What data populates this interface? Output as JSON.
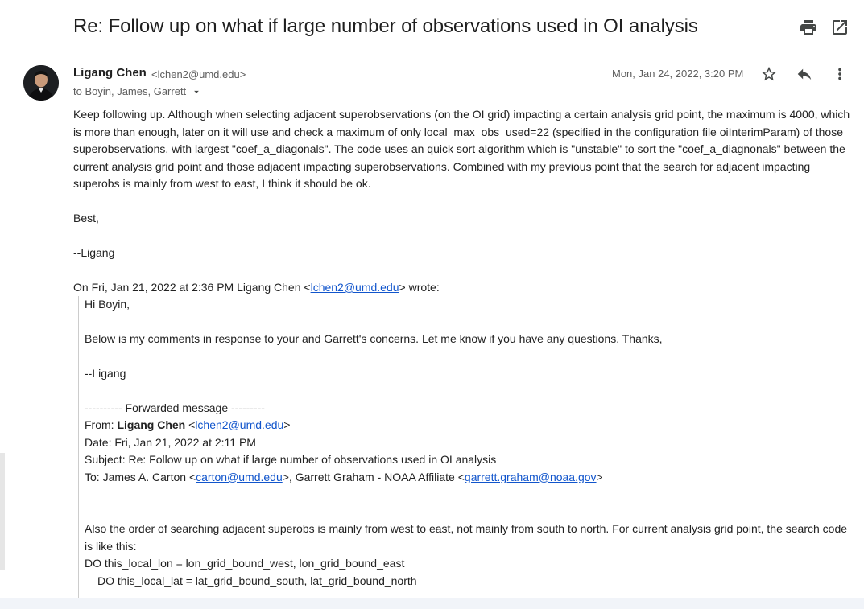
{
  "email": {
    "subject": "Re: Follow up on what if large number of observations used in OI analysis",
    "sender_name": "Ligang Chen",
    "sender_email": "<lchen2@umd.edu>",
    "recipients": "to Boyin, James, Garrett",
    "date": "Mon, Jan 24, 2022, 3:20 PM",
    "body_paragraph": "Keep following up. Although when selecting adjacent superobservations (on the OI grid) impacting a certain analysis grid point, the maximum is 4000, which is more than enough, later on it will use and check a maximum of only local_max_obs_used=22 (specified in the configuration file oiInterimParam) of those superobservations, with largest \"coef_a_diagonals\". The code uses an quick sort algorithm which is \"unstable\" to sort the \"coef_a_diagnonals\" between the current analysis grid point and those adjacent impacting superobservations. Combined with my previous point that the search for adjacent impacting superobs is mainly from west to east, I think it should be ok.",
    "closing": "Best,",
    "signature": "--Ligang",
    "quote_intro_prefix": "On Fri, Jan 21, 2022 at 2:36 PM Ligang Chen <",
    "quote_intro_link": "lchen2@umd.edu",
    "quote_intro_suffix": "> wrote:"
  },
  "quoted": {
    "greeting": "Hi Boyin,",
    "comment": "Below is my comments in response to your and Garrett's concerns. Let me know if you have any questions. Thanks,",
    "signature": "--Ligang",
    "forwarded_header": "---------- Forwarded message ---------",
    "from_label": "From: ",
    "from_name": "Ligang Chen",
    "from_open": " <",
    "from_email": "lchen2@umd.edu",
    "from_close": ">",
    "date_line": "Date: Fri, Jan 21, 2022 at 2:11 PM",
    "subject_line": "Subject: Re: Follow up on what if large number of observations used in OI analysis",
    "to_label": "To: James A. Carton <",
    "to_email1": "carton@umd.edu",
    "to_mid": ">, Garrett Graham - NOAA Affiliate <",
    "to_email2": "garrett.graham@noaa.gov",
    "to_close": ">",
    "order_paragraph": "Also the order of searching adjacent superobs is mainly from west to east, not mainly from south to north. For current analysis grid point, the search code is like this:",
    "code_line1": "DO this_local_lon = lon_grid_bound_west, lon_grid_bound_east",
    "code_line2": "DO this_local_lat = lat_grid_bound_south, lat_grid_bound_north"
  },
  "icons": {
    "print": "print-icon",
    "open_new_window": "open-in-new-icon",
    "star": "star-icon",
    "reply": "reply-icon",
    "more": "more-vert-icon",
    "recipients_dropdown": "arrow-drop-down-icon"
  },
  "colors": {
    "link": "#1155cc",
    "text": "#222222",
    "muted": "#5e5e5e"
  }
}
